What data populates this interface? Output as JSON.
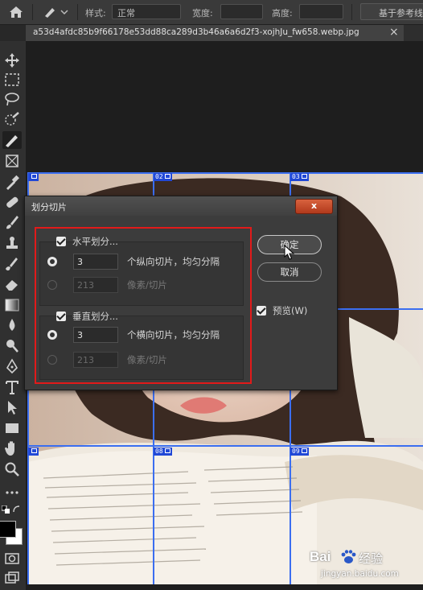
{
  "options_bar": {
    "style_label": "样式:",
    "style_value": "正常",
    "width_label": "宽度:",
    "height_label": "高度:",
    "guides_button": "基于参考线"
  },
  "document_tab": {
    "title": "a53d4afdc85b9f66178e53dd88ca289d3b46a6a6d2f3-xojhJu_fw658.webp.jpg",
    "close": "×"
  },
  "slices": {
    "s1": "",
    "s2": "02",
    "s3": "03",
    "s7": "",
    "s8": "08",
    "s9": "09"
  },
  "dialog": {
    "title": "划分切片",
    "close": "x",
    "horizontal": {
      "checkbox_label": "水平划分...",
      "count_value": "3",
      "count_suffix": "个纵向切片，均匀分隔",
      "pixels_value": "213",
      "pixels_suffix": "像素/切片"
    },
    "vertical": {
      "checkbox_label": "垂直划分...",
      "count_value": "3",
      "count_suffix": "个横向切片，均匀分隔",
      "pixels_value": "213",
      "pixels_suffix": "像素/切片"
    },
    "ok_button": "确定",
    "cancel_button": "取消",
    "preview_label": "预览(W)"
  },
  "watermark": {
    "brand": "Bai",
    "brand_cn": "经验",
    "url": "jingyan.baidu.com"
  },
  "colors": {
    "guide": "#3b6ef0",
    "highlight": "#e21a1a",
    "close_button": "#c44a2a"
  }
}
